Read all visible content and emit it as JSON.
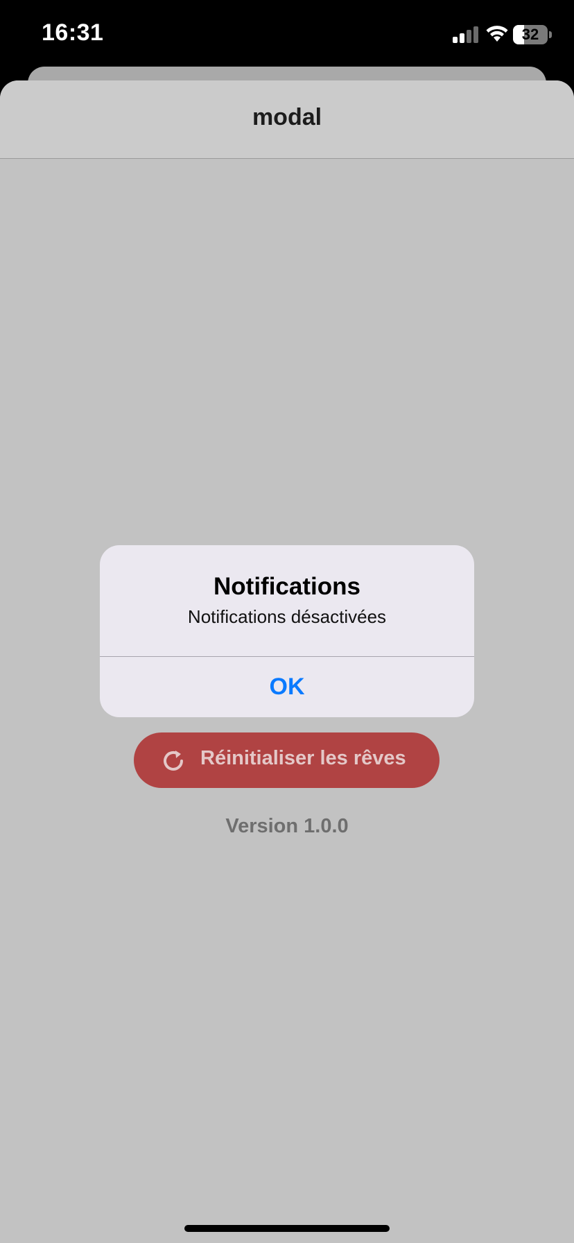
{
  "status_bar": {
    "time": "16:31",
    "battery_level": "32",
    "battery_fraction": 0.32,
    "icons": [
      "signal-icon",
      "wifi-icon",
      "battery-icon"
    ]
  },
  "sheet": {
    "title": "modal"
  },
  "settings": {
    "reset_button_label": "Réinitialiser les rêves",
    "reset_icon": "refresh-icon",
    "version_text": "Version 1.0.0"
  },
  "alert": {
    "title": "Notifications",
    "message": "Notifications désactivées",
    "ok_label": "OK"
  },
  "colors": {
    "accent": "#0a7aff",
    "danger": "#b04343",
    "sheet_background": "#c2c2c2"
  }
}
